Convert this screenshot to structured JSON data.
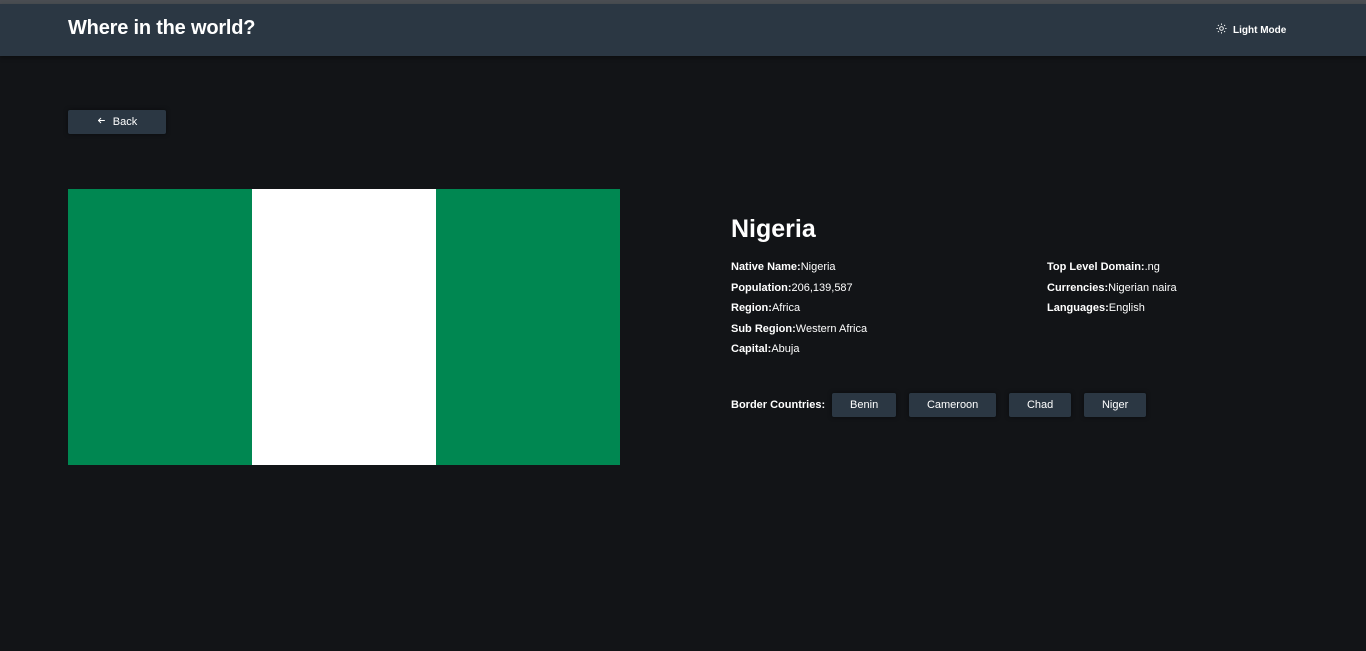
{
  "header": {
    "title": "Where in the world?",
    "mode_label": "Light Mode",
    "mode_icon": "sun-icon"
  },
  "back": {
    "label": "Back",
    "icon": "arrow-left-icon"
  },
  "country": {
    "name": "Nigeria",
    "flag": {
      "colors": [
        "#008751",
        "#ffffff",
        "#008751"
      ]
    },
    "details_left": [
      {
        "label": "Native Name:",
        "value": "Nigeria"
      },
      {
        "label": "Population:",
        "value": "206,139,587"
      },
      {
        "label": "Region:",
        "value": "Africa"
      },
      {
        "label": "Sub Region:",
        "value": "Western Africa"
      },
      {
        "label": "Capital:",
        "value": "Abuja"
      }
    ],
    "details_right": [
      {
        "label": "Top Level Domain:",
        "value": ".ng"
      },
      {
        "label": "Currencies:",
        "value": "Nigerian naira"
      },
      {
        "label": "Languages:",
        "value": "English"
      }
    ],
    "border_label": "Border Countries:",
    "borders": [
      "Benin",
      "Cameroon",
      "Chad",
      "Niger"
    ]
  },
  "colors": {
    "background": "#121417",
    "element": "#2b3743",
    "text": "#ffffff"
  }
}
